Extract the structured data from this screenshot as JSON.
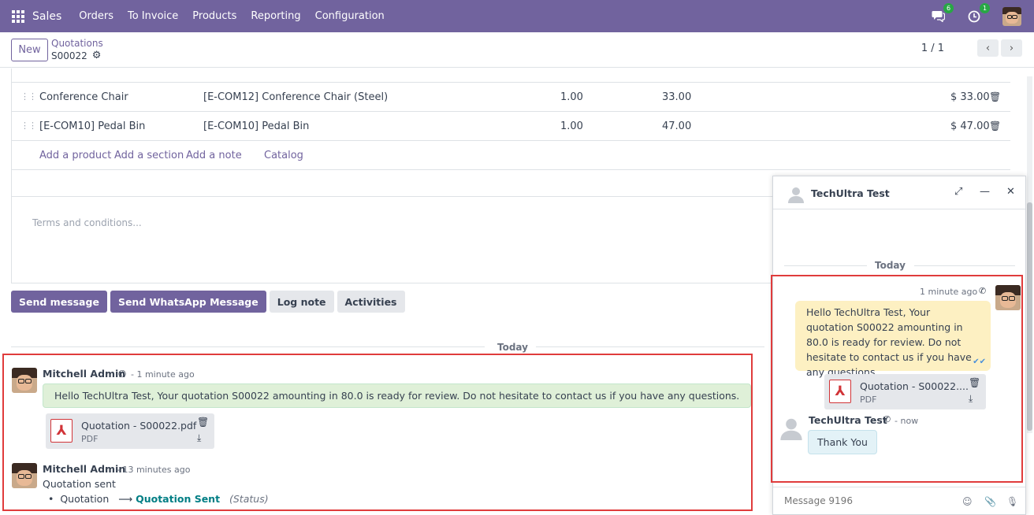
{
  "navbar": {
    "app_name": "Sales",
    "menu": [
      "Orders",
      "To Invoice",
      "Products",
      "Reporting",
      "Configuration"
    ],
    "messages_badge": "6",
    "activities_badge": "1",
    "color": "#71639e"
  },
  "control_panel": {
    "new_label": "New",
    "breadcrumb": "Quotations",
    "record_name": "S00022",
    "pager": "1 / 1"
  },
  "order_lines": [
    {
      "product": "Conference Chair",
      "description": "[E-COM12] Conference Chair (Steel)",
      "quantity": "1.00",
      "unit_price": "33.00",
      "subtotal": "$ 33.00"
    },
    {
      "product": "[E-COM10] Pedal Bin",
      "description": "[E-COM10] Pedal Bin",
      "quantity": "1.00",
      "unit_price": "47.00",
      "subtotal": "$ 47.00"
    }
  ],
  "line_actions": {
    "add_product": "Add a product",
    "add_section": "Add a section",
    "add_note": "Add a note",
    "catalog": "Catalog"
  },
  "terms_placeholder": "Terms and conditions...",
  "chatter": {
    "buttons": {
      "send_message": "Send message",
      "send_whatsapp": "Send WhatsApp Message",
      "log_note": "Log note",
      "activities": "Activities"
    },
    "day_label": "Today",
    "messages": [
      {
        "author": "Mitchell Admin",
        "time": "- 1 minute ago",
        "body": "Hello TechUltra Test, Your quotation S00022 amounting in 80.0 is ready for review. Do not hesitate to contact us if you have any questions.",
        "attachment": {
          "name": "Quotation - S00022.pdf",
          "type": "PDF"
        }
      },
      {
        "author": "Mitchell Admin",
        "time": "- 13 minutes ago",
        "body": "Quotation sent",
        "tracking": {
          "field": "Quotation",
          "new_value": "Quotation Sent",
          "label": "(Status)"
        }
      }
    ]
  },
  "chat_window": {
    "partner_name": "TechUltra Test",
    "day_label": "Today",
    "outgoing": {
      "time": "1 minute ago",
      "body": "Hello TechUltra Test, Your quotation S00022 amounting in 80.0 is ready for review. Do not hesitate to contact us if you have any questions.",
      "attachment": {
        "name": "Quotation - S00022....",
        "type": "PDF"
      }
    },
    "incoming": {
      "author": "TechUltra Test",
      "time": "- now",
      "body": "Thank You"
    },
    "composer_placeholder": "Message 9196"
  }
}
